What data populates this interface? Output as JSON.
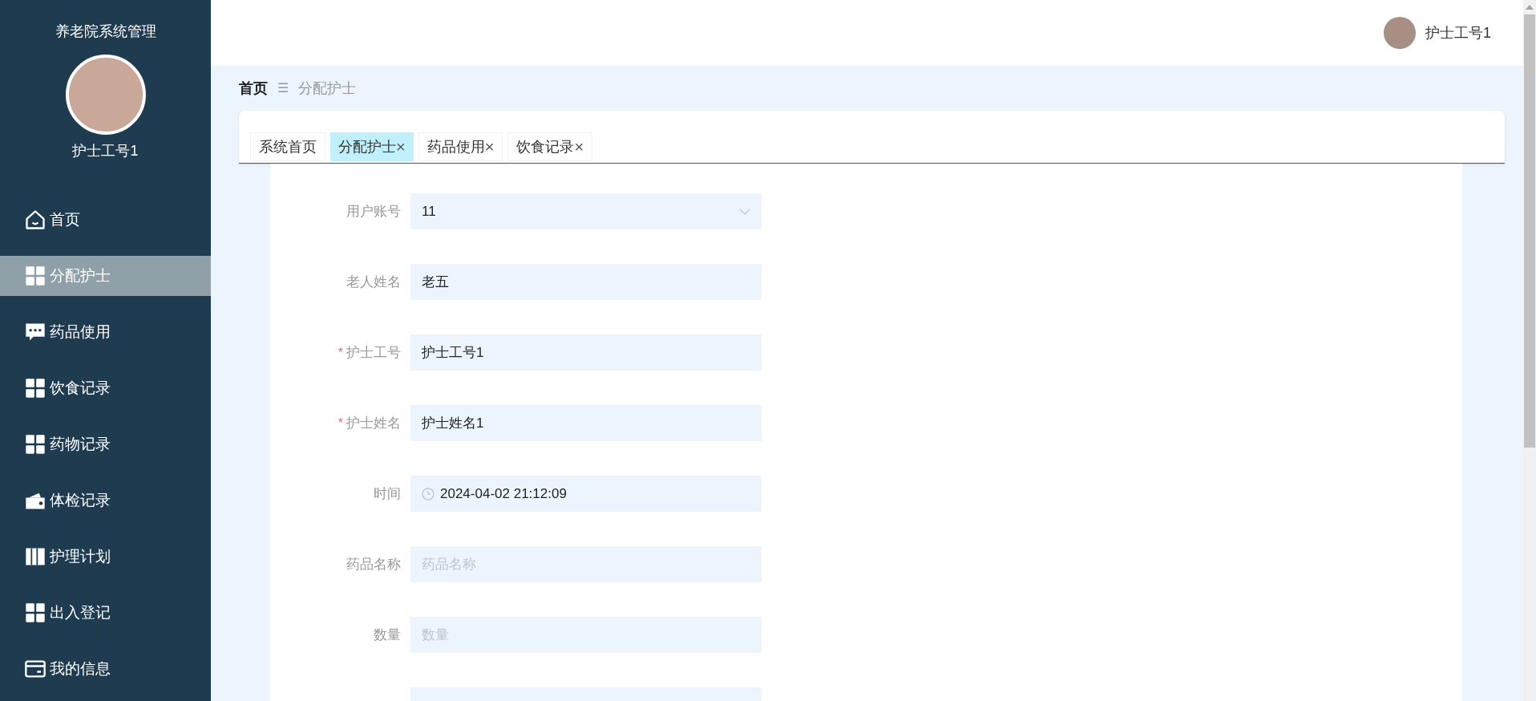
{
  "sidebar": {
    "title": "养老院系统管理",
    "user_name": "护士工号1",
    "items": [
      {
        "label": "首页",
        "kind": "home",
        "selected": false
      },
      {
        "label": "分配护士",
        "kind": "grid",
        "selected": true
      },
      {
        "label": "药品使用",
        "kind": "chat",
        "selected": false
      },
      {
        "label": "饮食记录",
        "kind": "grid",
        "selected": false
      },
      {
        "label": "药物记录",
        "kind": "grid",
        "selected": false
      },
      {
        "label": "体检记录",
        "kind": "wallet",
        "selected": false
      },
      {
        "label": "护理计划",
        "kind": "book",
        "selected": false
      },
      {
        "label": "出入登记",
        "kind": "grid",
        "selected": false
      },
      {
        "label": "我的信息",
        "kind": "card",
        "selected": false
      }
    ]
  },
  "header": {
    "user_name": "护士工号1"
  },
  "breadcrumb": {
    "home": "首页",
    "separator": "☰",
    "current": "分配护士"
  },
  "tabs": [
    {
      "label": "系统首页",
      "closable": false,
      "selected": false
    },
    {
      "label": "分配护士",
      "closable": true,
      "selected": true
    },
    {
      "label": "药品使用",
      "closable": true,
      "selected": false
    },
    {
      "label": "饮食记录",
      "closable": true,
      "selected": false
    }
  ],
  "close_glyph": "×",
  "form": {
    "fields": [
      {
        "label": "用户账号",
        "kind": "select",
        "value": "11",
        "required": false
      },
      {
        "label": "老人姓名",
        "kind": "text",
        "value": "老五",
        "required": false
      },
      {
        "label": "护士工号",
        "kind": "text",
        "value": "护士工号1",
        "required": true
      },
      {
        "label": "护士姓名",
        "kind": "text",
        "value": "护士姓名1",
        "required": true
      },
      {
        "label": "时间",
        "kind": "datetime",
        "value": "2024-04-02 21:12:09",
        "required": false
      },
      {
        "label": "药品名称",
        "kind": "text",
        "placeholder": "药品名称",
        "required": false
      },
      {
        "label": "数量",
        "kind": "text",
        "placeholder": "数量",
        "required": false
      }
    ],
    "required_mark": "*"
  }
}
